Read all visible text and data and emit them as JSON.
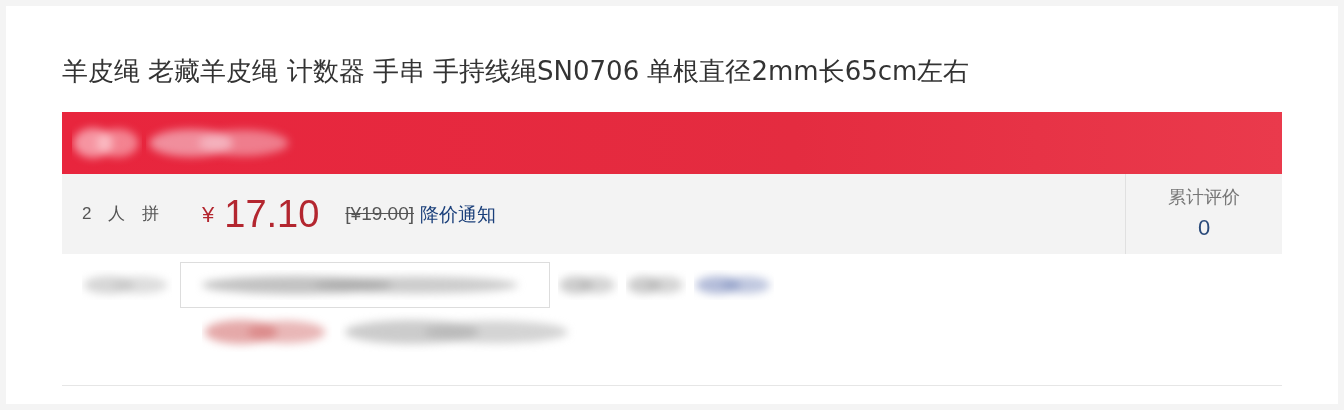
{
  "product": {
    "title": "羊皮绳 老藏羊皮绳 计数器 手串 手持线绳SN0706 单根直径2mm长65cm左右"
  },
  "price_box": {
    "group_label": "2 人 拼",
    "currency": "¥",
    "price": "17.10",
    "original_price": "[¥19.00]",
    "notify_link": "降价通知",
    "reviews_label": "累计评价",
    "reviews_count": "0"
  }
}
